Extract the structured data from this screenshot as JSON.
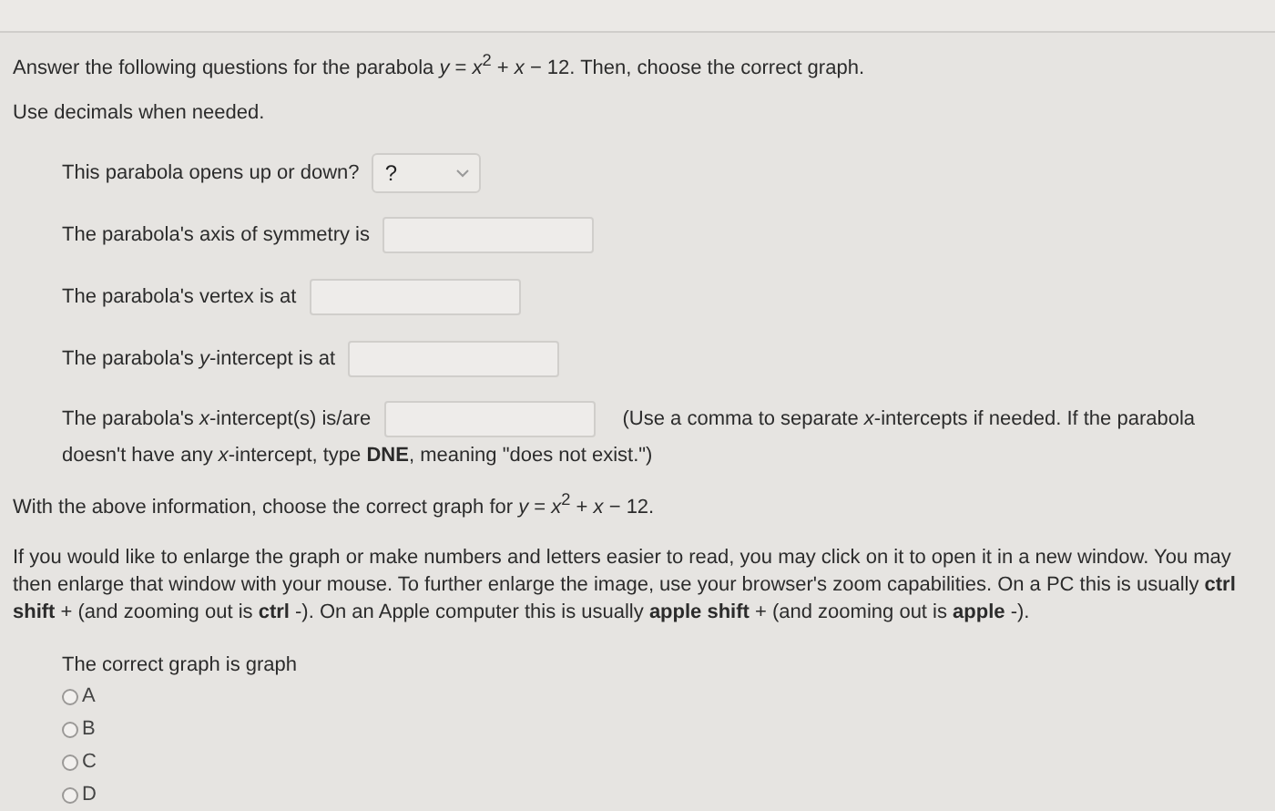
{
  "intro": "Answer the following questions for the parabola *y* = *x*$^{2}$ + *x* − 12. Then, choose the correct graph.",
  "note": "Use decimals when needed.",
  "questions": [
    {
      "kind": "select",
      "label": "This parabola opens up or down?",
      "value": "?"
    },
    {
      "kind": "text",
      "label": "The parabola's axis of symmetry is"
    },
    {
      "kind": "text",
      "label": "The parabola's vertex is at"
    },
    {
      "kind": "text",
      "label": "The parabola's *y*-intercept is at"
    },
    {
      "kind": "text",
      "label": "The parabola's *x*-intercept(s) is/are",
      "hint": "(Use a comma to separate *x*-intercepts if needed. If the parabola",
      "hint_continued": "doesn't have any *x*-intercept, type **DNE**, meaning \"does not exist.\")"
    }
  ],
  "graph_prompt": "With the above information, choose the correct graph for *y* = *x*$^{2}$ + *x* − 12.",
  "zoom_help": "If you would like to enlarge the graph or make numbers and letters easier to read, you may click on it to open it in a new window. You may then enlarge that window with your mouse. To further enlarge the image, use your browser's zoom capabilities. On a PC this is usually **ctrl shift** + (and zooming out is **ctrl** -). On an Apple computer this is usually **apple shift** + (and zooming out is **apple** -).",
  "graph_question": "The correct graph is graph",
  "options": [
    {
      "label": "A",
      "selected": false
    },
    {
      "label": "B",
      "selected": false
    },
    {
      "label": "C",
      "selected": false
    },
    {
      "label": "D",
      "selected": false
    }
  ]
}
